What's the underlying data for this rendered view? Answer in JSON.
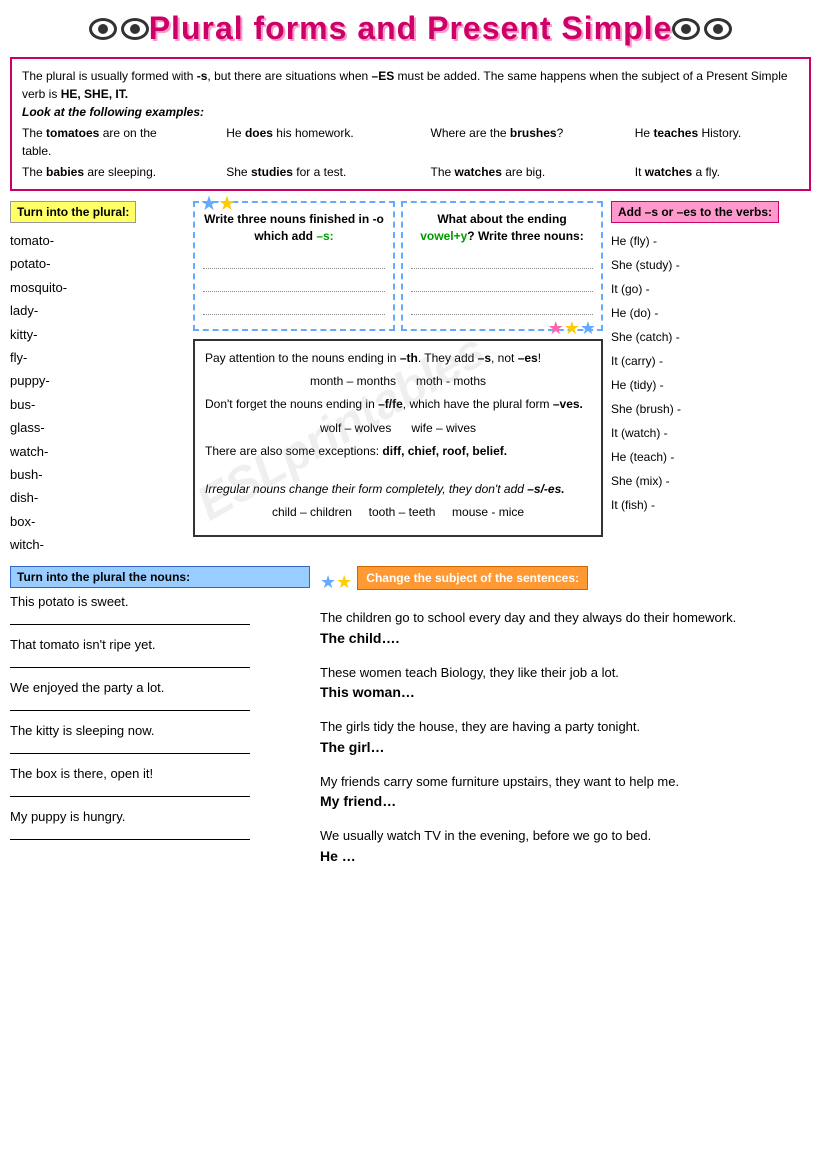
{
  "header": {
    "title": "Plural forms and Present Simple",
    "eyes_left": [
      "👁",
      "👁"
    ],
    "eyes_right": [
      "👁",
      "👁"
    ]
  },
  "info_box": {
    "text": "The plural is usually formed with -s, but there are situations when –ES must be added. The same happens when the subject of a Present Simple verb is HE, SHE, IT.",
    "label": "Look at the following examples:",
    "examples": [
      {
        "text": "The tomatoes are on the table."
      },
      {
        "text": "He does his homework."
      },
      {
        "text": "Where are the brushes?"
      },
      {
        "text": "He teaches History."
      },
      {
        "text": "The babies are sleeping."
      },
      {
        "text": "She studies for a test."
      },
      {
        "text": "The watches are big."
      },
      {
        "text": "It watches a fly."
      }
    ]
  },
  "turn_plural": {
    "header": "Turn into the plural:",
    "words": [
      "tomato-",
      "potato-",
      "mosquito-",
      "lady-",
      "kitty-",
      "fly-",
      "puppy-",
      "bus-",
      "glass-",
      "watch-",
      "bush-",
      "dish-",
      "box-",
      "witch-"
    ]
  },
  "write_nouns_o": {
    "title": "Write three nouns finished in -o which add –s:",
    "lines": [
      "...............................",
      "...............................",
      "..............................."
    ]
  },
  "write_nouns_vowel": {
    "title": "What about the ending vowel+y? Write three nouns:",
    "lines": [
      "...............................",
      "...............................",
      "..............................."
    ]
  },
  "note_box": {
    "lines": [
      "Pay attention to the nouns ending in –th. They add –s, not –es!",
      "month – months       moth - moths",
      "Don't forget the nouns ending in –f/fe, which have the plural form –ves.",
      "wolf – wolves        wife – wives",
      "There are also some exceptions: diff, chief, roof, belief.",
      "Irregular nouns change their form completely, they don't add –s/-es.",
      "child – children     tooth – teeth      mouse - mice"
    ]
  },
  "add_verbs": {
    "header": "Add –s or –es to the verbs:",
    "items": [
      "He (fly) -",
      "She (study) -",
      "It (go) -",
      "He (do) -",
      "She (catch) -",
      "It (carry) -",
      "He (tidy) -",
      "She (brush) -",
      "It (watch) -",
      "He (teach) -",
      "She (mix) -",
      "It (fish) -"
    ]
  },
  "turn_nouns": {
    "header": "Turn into the plural the nouns:",
    "sentences": [
      "This potato is sweet.",
      "That tomato isn't ripe yet.",
      "We enjoyed the party a lot.",
      "The kitty is sleeping now.",
      "The box is there, open it!",
      "My puppy is hungry."
    ]
  },
  "change_subject": {
    "header": "Change the subject of the sentences:",
    "items": [
      {
        "original": "The children go to school every day and they always do their homework.",
        "prompt": "The child…."
      },
      {
        "original": "These women teach Biology, they like their job a lot.",
        "prompt": "This woman…"
      },
      {
        "original": "The girls tidy the house, they are having a party tonight.",
        "prompt": "The girl…"
      },
      {
        "original": "My friends carry some furniture upstairs, they want to help me.",
        "prompt": "My friend…"
      },
      {
        "original": "We usually watch TV in the evening, before we go to bed.",
        "prompt": "He …"
      }
    ]
  }
}
